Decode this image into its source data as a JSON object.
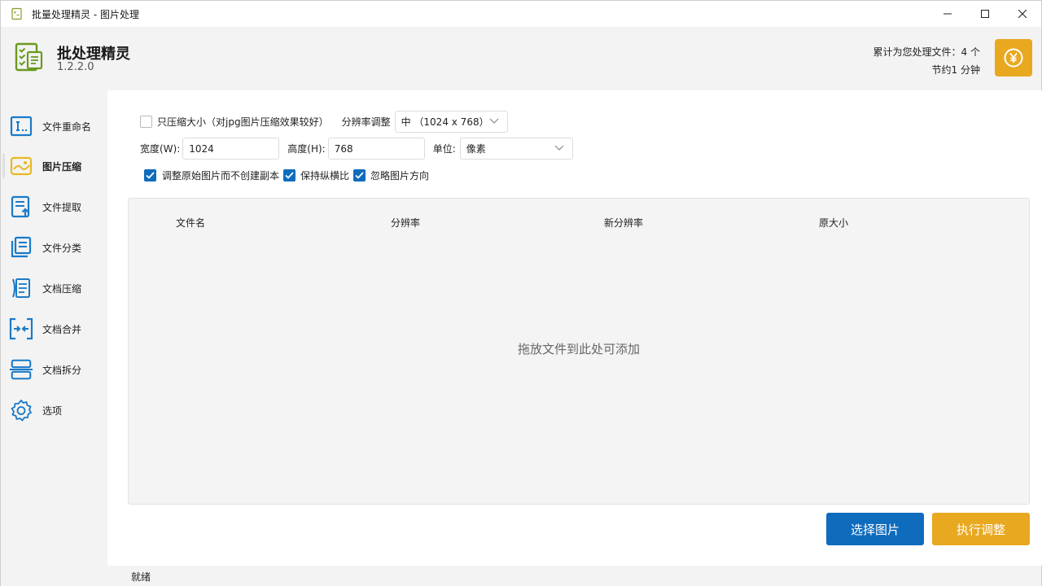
{
  "window": {
    "title": "批量处理精灵 - 图片处理"
  },
  "header": {
    "app_name": "批处理精灵",
    "version": "1.2.2.0",
    "stats_files": "累计为您处理文件：4 个",
    "stats_time": "节约1 分钟"
  },
  "sidebar": {
    "items": [
      {
        "label": "文件重命名",
        "icon": "rename-icon"
      },
      {
        "label": "图片压缩",
        "icon": "image-compress-icon"
      },
      {
        "label": "文件提取",
        "icon": "file-extract-icon"
      },
      {
        "label": "文件分类",
        "icon": "file-classify-icon"
      },
      {
        "label": "文档压缩",
        "icon": "doc-compress-icon"
      },
      {
        "label": "文档合并",
        "icon": "doc-merge-icon"
      },
      {
        "label": "文档拆分",
        "icon": "doc-split-icon"
      },
      {
        "label": "选项",
        "icon": "gear-icon"
      }
    ],
    "active_index": 1
  },
  "options": {
    "compress_only_label": "只压缩大小（对jpg图片压缩效果较好）",
    "compress_only_checked": false,
    "resolution_label": "分辨率调整",
    "resolution_value": "中 （1024 x 768）",
    "width_label": "宽度(W):",
    "width_value": "1024",
    "height_label": "高度(H):",
    "height_value": "768",
    "unit_label": "单位:",
    "unit_value": "像素",
    "modify_original_label": "调整原始图片而不创建副本",
    "modify_original_checked": true,
    "keep_ratio_label": "保持纵横比",
    "keep_ratio_checked": true,
    "ignore_orientation_label": "忽略图片方向",
    "ignore_orientation_checked": true
  },
  "filelist": {
    "columns": [
      "文件名",
      "分辨率",
      "新分辨率",
      "原大小"
    ],
    "drop_hint": "拖放文件到此处可添加"
  },
  "actions": {
    "select_label": "选择图片",
    "run_label": "执行调整"
  },
  "status": {
    "text": "就绪"
  },
  "colors": {
    "accent_blue": "#0f6cbd",
    "accent_gold": "#e8a820",
    "icon_blue": "#1a7ac8",
    "logo_green": "#6a9a1f"
  }
}
